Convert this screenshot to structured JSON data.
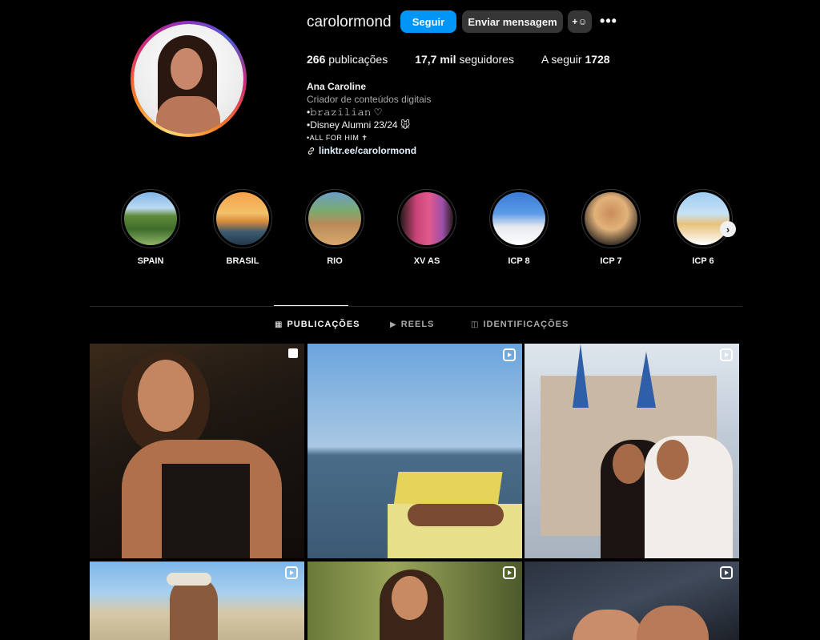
{
  "profile": {
    "username": "carolormond",
    "follow_label": "Seguir",
    "message_label": "Enviar mensagem",
    "add_icon": "+☺",
    "more_label": "•••",
    "stats": {
      "posts_count": "266",
      "posts_label": "publicações",
      "followers_count": "17,7 mil",
      "followers_label": "seguidores",
      "following_label": "A seguir",
      "following_count": "1728"
    },
    "bio": {
      "name": "Ana Caroline",
      "category": "Criador de conteúdos digitais",
      "line1": "•𝚋𝚛𝚊𝚣𝚒𝚕𝚒𝚊𝚗 ♡",
      "line2": "•Disney Alumni 23/24 🐭",
      "line3": "•ALL FOR HIM ✝",
      "link": "linktr.ee/carolormond"
    }
  },
  "highlights": [
    {
      "label": "SPAIN"
    },
    {
      "label": "BRASIL"
    },
    {
      "label": "RIO"
    },
    {
      "label": "XV AS"
    },
    {
      "label": "ICP 8"
    },
    {
      "label": "ICP 7"
    },
    {
      "label": "ICP 6"
    }
  ],
  "highlights_next": "›",
  "tabs": [
    {
      "label": "PUBLICAÇÕES",
      "icon": "▦"
    },
    {
      "label": "REELS",
      "icon": "▶"
    },
    {
      "label": "IDENTIFICAÇÕES",
      "icon": "◫"
    }
  ]
}
